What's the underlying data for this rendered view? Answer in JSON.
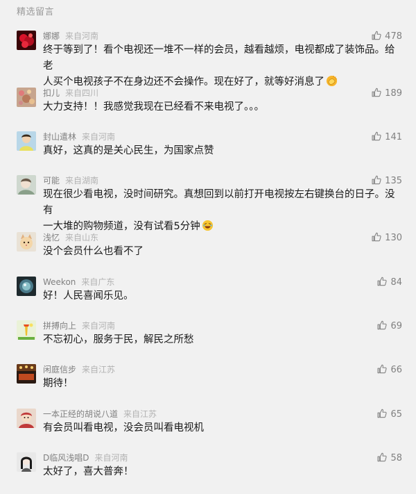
{
  "section_title": "精选留言",
  "colors": {
    "background": "#f1f1f1",
    "nickname": "#808080",
    "location": "#b2b2b2",
    "text": "#1a1a1a"
  },
  "comments": [
    {
      "nickname": "娜娜",
      "location": "来自河南",
      "text_lines": [
        "终于等到了！看个电视还一堆不一样的会员，越看越烦，电视都成了装饰品。给老",
        "人买个电视孩子不在身边还不会操作。现在好了，就等好消息了"
      ],
      "emoji": "clapping-emoji",
      "likes": "478"
    },
    {
      "nickname": "扣儿",
      "location": "来自四川",
      "text_lines": [
        "大力支持！！我感觉我现在已经看不来电视了。。。"
      ],
      "likes": "189"
    },
    {
      "nickname": "封山遣林",
      "location": "来自河南",
      "text_lines": [
        "真好，这真的是关心民生，为国家点赞"
      ],
      "likes": "141"
    },
    {
      "nickname": "可能",
      "location": "来自湖南",
      "text_lines": [
        "现在很少看电视，没时间研究。真想回到以前打开电视按左右键换台的日子。没有",
        "一大堆的购物频道，没有试看5分钟"
      ],
      "emoji": "laughing-emoji",
      "likes": "135"
    },
    {
      "nickname": "浅忆",
      "location": "来自山东",
      "text_lines": [
        "没个会员什么也看不了"
      ],
      "likes": "130"
    },
    {
      "nickname": "Weekon",
      "location": "来自广东",
      "text_lines": [
        "好！人民喜闻乐见。"
      ],
      "likes": "84"
    },
    {
      "nickname": "拼搏向上",
      "location": "来自河南",
      "text_lines": [
        "不忘初心，服务于民，解民之所愁"
      ],
      "likes": "69"
    },
    {
      "nickname": "闲庭信步",
      "location": "来自江苏",
      "text_lines": [
        "期待！"
      ],
      "likes": "66"
    },
    {
      "nickname": "一本正经的胡说八道",
      "location": "来自江苏",
      "text_lines": [
        "有会员叫看电视，没会员叫看电视机"
      ],
      "likes": "65"
    },
    {
      "nickname": "D临风浅唱D",
      "location": "来自河南",
      "text_lines": [
        "太好了，喜大普奔！"
      ],
      "likes": "58"
    }
  ]
}
